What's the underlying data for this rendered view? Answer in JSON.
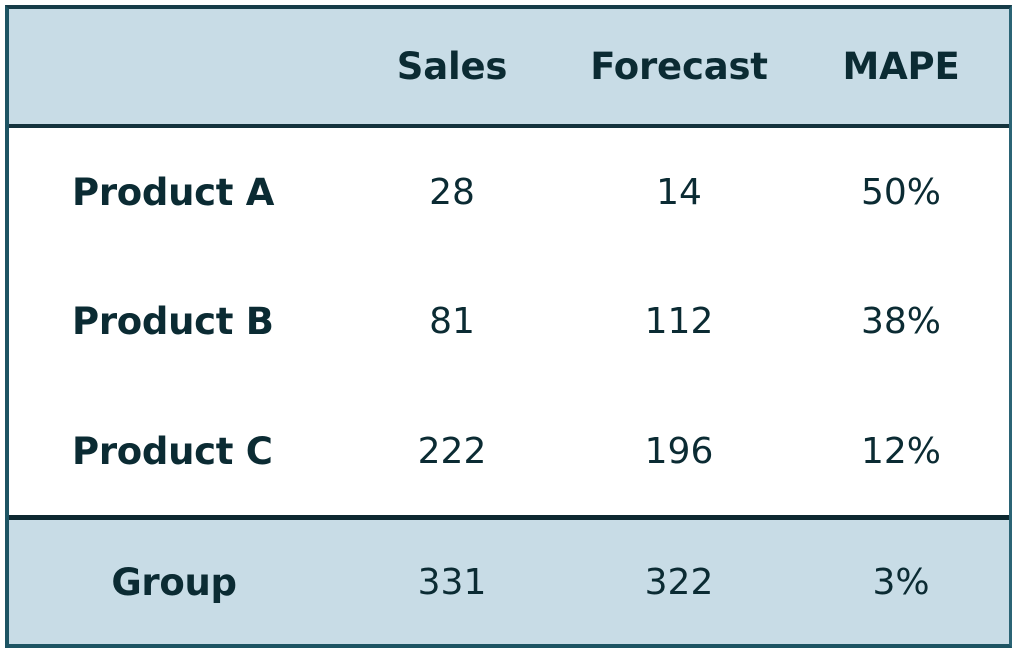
{
  "table": {
    "columns": [
      {
        "key": "label",
        "label": ""
      },
      {
        "key": "sales",
        "label": "Sales"
      },
      {
        "key": "forecast",
        "label": "Forecast"
      },
      {
        "key": "mape",
        "label": "MAPE"
      }
    ],
    "rows": [
      {
        "label": "Product A",
        "sales": "28",
        "forecast": "14",
        "mape": "50%"
      },
      {
        "label": "Product B",
        "sales": "81",
        "forecast": "112",
        "mape": "38%"
      },
      {
        "label": "Product C",
        "sales": "222",
        "forecast": "196",
        "mape": "12%"
      }
    ],
    "total_row": {
      "label": "Group",
      "sales": "331",
      "forecast": "322",
      "mape": "3%"
    },
    "colors": {
      "header_background": "#c8dce6",
      "total_background": "#c8dce6",
      "body_background": "#ffffff",
      "text": "#0b2b33",
      "border": "#163c48"
    }
  },
  "chart_data": {
    "type": "table",
    "title": "",
    "columns": [
      "",
      "Sales",
      "Forecast",
      "MAPE"
    ],
    "rows": [
      [
        "Product A",
        28,
        14,
        "50%"
      ],
      [
        "Product B",
        81,
        112,
        "38%"
      ],
      [
        "Product C",
        222,
        196,
        "12%"
      ],
      [
        "Group",
        331,
        322,
        "3%"
      ]
    ],
    "series": [
      {
        "name": "Sales",
        "categories": [
          "Product A",
          "Product B",
          "Product C",
          "Group"
        ],
        "values": [
          28,
          81,
          222,
          331
        ]
      },
      {
        "name": "Forecast",
        "categories": [
          "Product A",
          "Product B",
          "Product C",
          "Group"
        ],
        "values": [
          14,
          112,
          196,
          322
        ]
      },
      {
        "name": "MAPE",
        "categories": [
          "Product A",
          "Product B",
          "Product C",
          "Group"
        ],
        "values": [
          50,
          38,
          12,
          3
        ]
      }
    ]
  }
}
